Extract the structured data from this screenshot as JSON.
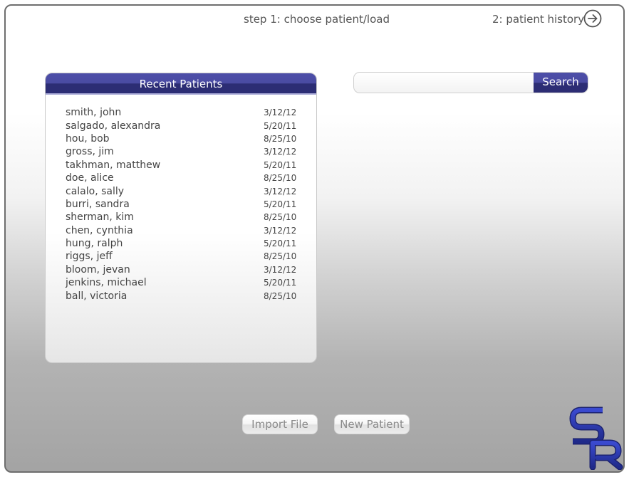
{
  "header": {
    "step1_label": "step 1: choose patient/load",
    "step2_label": "2: patient history",
    "next_icon": "arrow-right-circle-icon"
  },
  "recent_patients": {
    "title": "Recent Patients",
    "patients": [
      {
        "name": "smith, john",
        "date": "3/12/12"
      },
      {
        "name": "salgado, alexandra",
        "date": "5/20/11"
      },
      {
        "name": "hou, bob",
        "date": "8/25/10"
      },
      {
        "name": "gross, jim",
        "date": "3/12/12"
      },
      {
        "name": "takhman, matthew",
        "date": "5/20/11"
      },
      {
        "name": "doe, alice",
        "date": "8/25/10"
      },
      {
        "name": "calalo, sally",
        "date": "3/12/12"
      },
      {
        "name": "burri, sandra",
        "date": "5/20/11"
      },
      {
        "name": "sherman, kim",
        "date": "8/25/10"
      },
      {
        "name": "chen, cynthia",
        "date": "3/12/12"
      },
      {
        "name": "hung, ralph",
        "date": "5/20/11"
      },
      {
        "name": "riggs, jeff",
        "date": "8/25/10"
      },
      {
        "name": "bloom, jevan",
        "date": "3/12/12"
      },
      {
        "name": "jenkins, michael",
        "date": "5/20/11"
      },
      {
        "name": "ball, victoria",
        "date": "8/25/10"
      }
    ]
  },
  "search": {
    "value": "",
    "placeholder": "",
    "button_label": "Search"
  },
  "actions": {
    "import_label": "Import File",
    "new_patient_label": "New Patient"
  },
  "logo": {
    "text": "SR",
    "color": "#2f3fb0"
  },
  "colors": {
    "accent": "#4a4ba2",
    "accent_dark": "#2c2d74"
  }
}
